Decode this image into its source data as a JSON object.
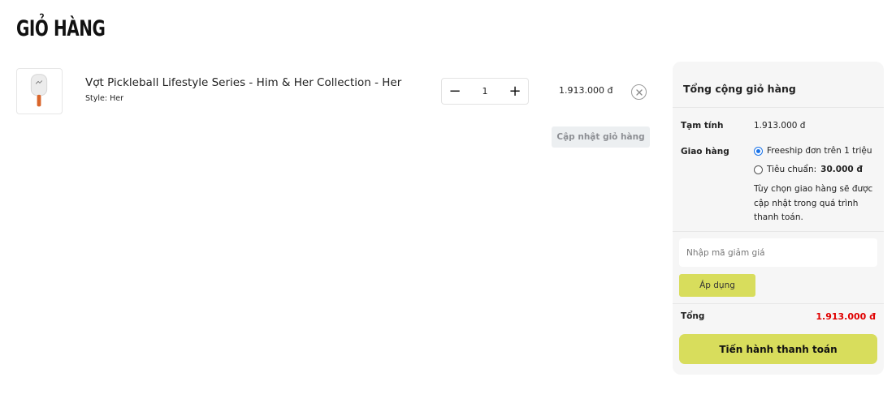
{
  "page": {
    "title": "GIỎ HÀNG"
  },
  "cart": {
    "item": {
      "name": "Vợt Pickleball Lifestyle Series - Him & Her Collection - Her",
      "variant": "Style: Her",
      "quantity": "1",
      "price": "1.913.000 đ",
      "image_icon": "paddle-image"
    },
    "update_label": "Cập nhật giỏ hàng"
  },
  "summary": {
    "title": "Tổng cộng giỏ hàng",
    "subtotal_label": "Tạm tính",
    "subtotal_value": "1.913.000 đ",
    "shipping_label": "Giao hàng",
    "shipping_options": [
      {
        "label": "Freeship đơn trên 1 triệu",
        "selected": true
      },
      {
        "label": "Tiêu chuẩn:",
        "price": "30.000 đ",
        "selected": false
      }
    ],
    "shipping_note": "Tùy chọn giao hàng sẽ được cập nhật trong quá trình thanh toán.",
    "coupon_placeholder": "Nhập mã giảm giá",
    "apply_label": "Áp dụng",
    "total_label": "Tổng",
    "total_value": "1.913.000 đ",
    "checkout_label": "Tiến hành thanh toán"
  },
  "colors": {
    "accent": "#d8dd5c",
    "total": "#e00000",
    "panel": "#f6f6f6",
    "radio_selected": "#1a73e8"
  }
}
